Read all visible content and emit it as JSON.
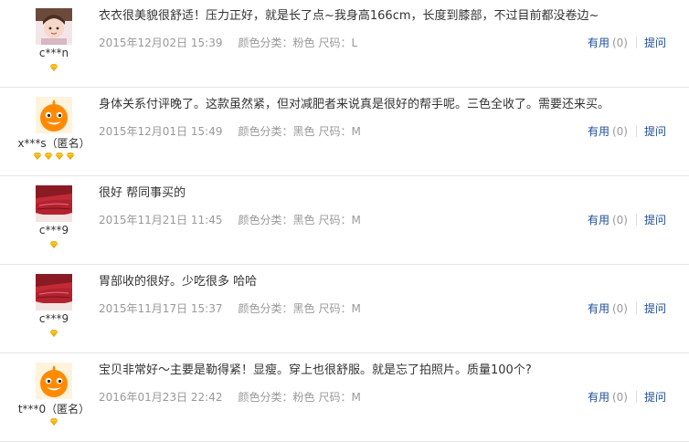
{
  "reviews": [
    {
      "avatar": "girl-photo",
      "nickname": "c***n",
      "rank_count": 1,
      "content": "衣衣很美貌很舒适！压力正好，就是长了点~我身高166cm，长度到膝部，不过目前都没卷边~",
      "date": "2015年12月02日 15:39",
      "spec": "颜色分类：粉色",
      "size": "尺码：L",
      "useful_label": "有用",
      "useful_count": "(0)",
      "ask_label": "提问"
    },
    {
      "avatar": "orange-mascot",
      "nickname": "x***s（匿名）",
      "rank_count": 4,
      "content": "身体关系付评晚了。这款虽然紧，但对减肥者来说真是很好的帮手呢。三色全收了。需要还来买。",
      "date": "2015年12月01日 15:49",
      "spec": "颜色分类：黑色",
      "size": "尺码：M",
      "useful_label": "有用",
      "useful_count": "(0)",
      "ask_label": "提问"
    },
    {
      "avatar": "red-lips",
      "nickname": "c***9",
      "rank_count": 1,
      "content": "很好 帮同事买的",
      "date": "2015年11月21日 11:45",
      "spec": "颜色分类：黑色",
      "size": "尺码：M",
      "useful_label": "有用",
      "useful_count": "(0)",
      "ask_label": "提问"
    },
    {
      "avatar": "red-lips",
      "nickname": "c***9",
      "rank_count": 1,
      "content": "胃部收的很好。少吃很多 哈哈",
      "date": "2015年11月17日 15:37",
      "spec": "颜色分类：黑色",
      "size": "尺码：M",
      "useful_label": "有用",
      "useful_count": "(0)",
      "ask_label": "提问"
    },
    {
      "avatar": "orange-mascot",
      "nickname": "t***0（匿名）",
      "rank_count": 1,
      "content": "宝贝非常好～主要是勒得紧！显瘦。穿上也很舒服。就是忘了拍照片。质量100个?",
      "date": "2016年01月23日 22:42",
      "spec": "颜色分类：粉色",
      "size": "尺码：M",
      "useful_label": "有用",
      "useful_count": "(0)",
      "ask_label": "提问"
    }
  ],
  "colors": {
    "link": "#1f4d99",
    "meta": "#999999",
    "text": "#333333",
    "gem": "#f5b800"
  }
}
